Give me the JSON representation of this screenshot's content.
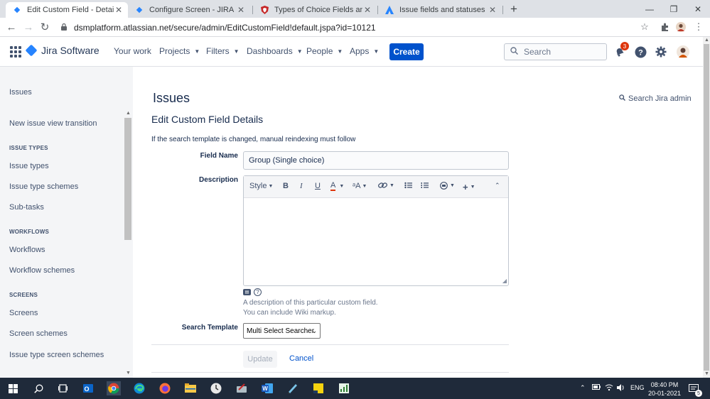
{
  "browser": {
    "tabs": [
      {
        "label": "Edit Custom Field - Details - JIRA",
        "active": true,
        "favicon": "jira-blue-diamond-icon"
      },
      {
        "label": "Configure Screen - JIRA",
        "active": false,
        "favicon": "jira-blue-diamond-icon"
      },
      {
        "label": "Types of Choice Fields and Wher",
        "active": false,
        "favicon": "shield-red-icon"
      },
      {
        "label": "Issue fields and statuses | Admin",
        "active": false,
        "favicon": "atlassian-logo-icon"
      }
    ],
    "url": "dsmplatform.atlassian.net/secure/admin/EditCustomField!default.jspa?id=10121"
  },
  "header": {
    "product": "Jira Software",
    "nav": [
      "Your work",
      "Projects",
      "Filters",
      "Dashboards",
      "People",
      "Apps"
    ],
    "create_label": "Create",
    "search_placeholder": "Search",
    "notification_count": "3"
  },
  "sidebar": {
    "top_link": "Issues",
    "items": [
      {
        "type": "link",
        "label": "New issue view transition"
      },
      {
        "type": "heading",
        "label": "ISSUE TYPES"
      },
      {
        "type": "link",
        "label": "Issue types"
      },
      {
        "type": "link",
        "label": "Issue type schemes"
      },
      {
        "type": "link",
        "label": "Sub-tasks"
      },
      {
        "type": "heading",
        "label": "WORKFLOWS"
      },
      {
        "type": "link",
        "label": "Workflows"
      },
      {
        "type": "link",
        "label": "Workflow schemes"
      },
      {
        "type": "heading",
        "label": "SCREENS"
      },
      {
        "type": "link",
        "label": "Screens"
      },
      {
        "type": "link",
        "label": "Screen schemes"
      },
      {
        "type": "link",
        "label": "Issue type screen schemes"
      }
    ]
  },
  "main": {
    "title": "Issues",
    "admin_search": "Search Jira admin",
    "subtitle": "Edit Custom Field Details",
    "note": "If the search template is changed, manual reindexing must follow",
    "field_name_label": "Field Name",
    "field_name_value": "Group (Single choice)",
    "description_label": "Description",
    "editor": {
      "style_label": "Style",
      "bold": "B",
      "italic": "I",
      "underline": "U",
      "text_color": "A",
      "font_size": "ᵃA"
    },
    "description_hint_1": "A description of this particular custom field.",
    "description_hint_2": "You can include Wiki markup.",
    "search_template_label": "Search Template",
    "search_template_value": "Multi Select Searcher",
    "update_label": "Update",
    "cancel_label": "Cancel"
  },
  "taskbar": {
    "language": "ENG",
    "time": "08:40 PM",
    "date": "20-01-2021",
    "notification_badge": "5"
  },
  "colors": {
    "primary": "#0052cc",
    "sidebar_bg": "#f4f5f7",
    "taskbar_bg": "#1f2a3a",
    "badge_red": "#de350b"
  }
}
